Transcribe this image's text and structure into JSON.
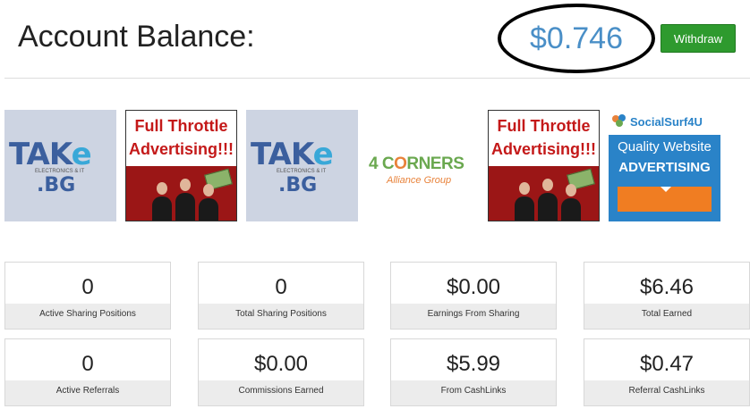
{
  "header": {
    "title": "Account Balance:",
    "balance": "$0.746",
    "withdraw_label": "Withdraw"
  },
  "ads": [
    {
      "name": "take-bg-ad",
      "logo_main": "TAKe",
      "logo_sub": "ELECTRONICS & IT",
      "logo_domain": ".BG"
    },
    {
      "name": "full-throttle-ad",
      "line1": "Full Throttle",
      "line2": "Advertising!!!"
    },
    {
      "name": "take-bg-ad-2",
      "logo_main": "TAKe",
      "logo_sub": "ELECTRONICS & IT",
      "logo_domain": ".BG"
    },
    {
      "name": "four-corners-ad",
      "logo_a": "4 C",
      "logo_b": "RNERS",
      "sub": "Alliance Group"
    },
    {
      "name": "full-throttle-ad-2",
      "line1": "Full Throttle",
      "line2": "Advertising!!!"
    },
    {
      "name": "socialsurf-ad",
      "brand": "SocialSurf4U",
      "line1": "Quality Website",
      "line2": "ADVERTISING"
    }
  ],
  "stats": [
    {
      "value": "0",
      "label": "Active Sharing Positions"
    },
    {
      "value": "0",
      "label": "Total Sharing Positions"
    },
    {
      "value": "$0.00",
      "label": "Earnings From Sharing"
    },
    {
      "value": "$6.46",
      "label": "Total Earned"
    },
    {
      "value": "0",
      "label": "Active Referrals"
    },
    {
      "value": "$0.00",
      "label": "Commissions Earned"
    },
    {
      "value": "$5.99",
      "label": "From CashLinks"
    },
    {
      "value": "$0.47",
      "label": "Referral CashLinks"
    }
  ],
  "colors": {
    "balance": "#4a8fc7",
    "withdraw": "#2e9a2e",
    "card_label_bg": "#ececec"
  }
}
